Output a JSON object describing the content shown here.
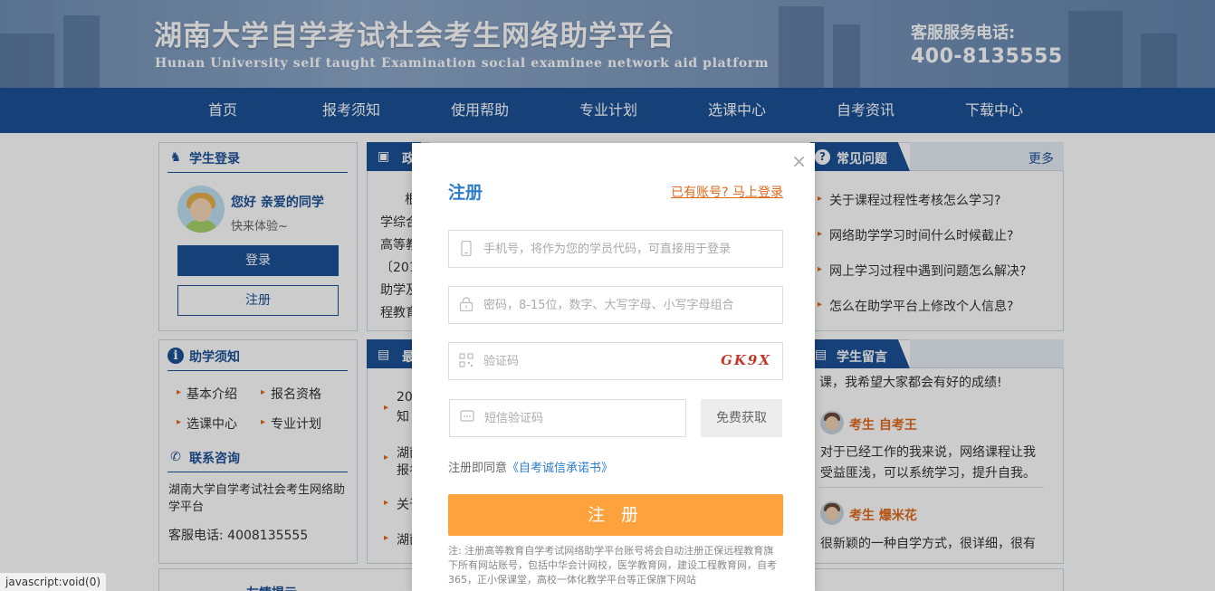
{
  "header": {
    "title": "湖南大学自学考试社会考生网络助学平台",
    "subtitle": "Hunan University self taught Examination social examinee network aid platform",
    "hotline_label": "客服服务电话:",
    "hotline_number": "400-8135555"
  },
  "nav": {
    "items": [
      {
        "label": "首页"
      },
      {
        "label": "报考须知"
      },
      {
        "label": "使用帮助"
      },
      {
        "label": "专业计划"
      },
      {
        "label": "选课中心"
      },
      {
        "label": "自考资讯"
      },
      {
        "label": "下载中心"
      }
    ]
  },
  "login_panel": {
    "title": "学生登录",
    "greeting": "您好 亲爱的同学",
    "hint": "快来体验~",
    "login_btn": "登录",
    "register_btn": "注册"
  },
  "help_panel": {
    "title": "助学须知",
    "links": [
      "基本介绍",
      "报名资格",
      "选课中心",
      "专业计划"
    ],
    "contact_title": "联系咨询",
    "contact_text": "湖南大学自学考试社会考生网络助学平台",
    "phone": "客服电话: 4008135555"
  },
  "mid_top": {
    "title_partial": "政",
    "lines": [
      "根",
      "学综合",
      "高等教",
      "〔201",
      "助学及",
      "程教育"
    ]
  },
  "mid_bottom": {
    "title_partial": "最",
    "items": [
      "20",
      "知",
      "湖南",
      "报名",
      "关于",
      "湖南"
    ]
  },
  "faq_panel": {
    "title": "常见问题",
    "more": "更多",
    "items": [
      "关于课程过程性考核怎么学习?",
      "网络助学学习时间什么时候截止?",
      "网上学习过程中遇到问题怎么解决?",
      "怎么在助学平台上修改个人信息?"
    ]
  },
  "msg_panel": {
    "title": "学生留言",
    "intro": "课，我希望大家都会有好的成绩!",
    "messages": [
      {
        "author": "考生 自考王",
        "line1": "对于已经工作的我来说，网络课程让我",
        "line2": "受益匪浅，可以系统学习，提升自我。"
      },
      {
        "author": "考生 爆米花",
        "line1": "很新颖的一种自学方式，很详细，很有",
        "line2": ""
      }
    ]
  },
  "tips_partial": "友情提示",
  "modal": {
    "title": "注册",
    "login_link": "已有账号? 马上登录",
    "close": "×",
    "phone_placeholder": "手机号，将作为您的学员代码，可直接用于登录",
    "password_placeholder": "密码，8-15位，数字、大写字母、小写字母组合",
    "captcha_placeholder": "验证码",
    "captcha_text": "GK9X",
    "sms_placeholder": "短信验证码",
    "sms_btn": "免费获取",
    "agree_prefix": "注册即同意",
    "agree_link": "《自考诚信承诺书》",
    "submit": "注 册",
    "note": "注: 注册高等教育自学考试网络助学平台账号将会自动注册正保远程教育旗下所有网站账号，包括中华会计网校，医学教育网，建设工程教育网，自考365，正小保课堂，高校一体化教学平台等正保旗下网站"
  },
  "status_bar": "javascript:void(0)"
}
